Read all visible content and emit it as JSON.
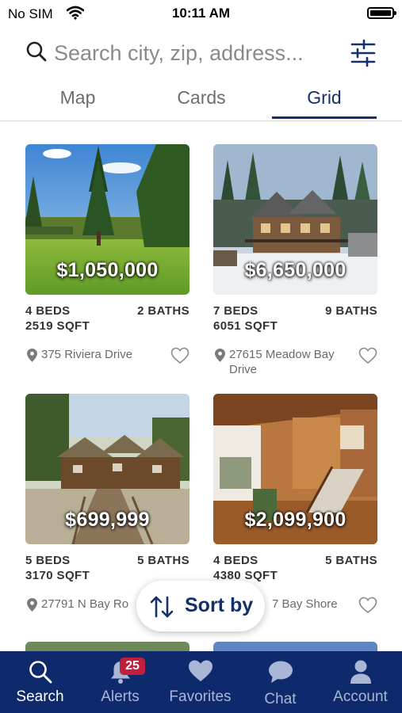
{
  "status_bar": {
    "carrier": "No SIM",
    "time": "10:11 AM"
  },
  "search": {
    "placeholder": "Search city, zip, address..."
  },
  "tabs": [
    {
      "label": "Map",
      "active": false
    },
    {
      "label": "Cards",
      "active": false
    },
    {
      "label": "Grid",
      "active": true
    }
  ],
  "listings": [
    {
      "price": "$1,050,000",
      "beds": "4 BEDS",
      "baths": "2 BATHS",
      "sqft": "2519 SQFT",
      "address": "375 Riviera Drive"
    },
    {
      "price": "$6,650,000",
      "beds": "7 BEDS",
      "baths": "9 BATHS",
      "sqft": "6051 SQFT",
      "address": "27615 Meadow Bay Drive"
    },
    {
      "price": "$699,999",
      "beds": "5 BEDS",
      "baths": "5 BATHS",
      "sqft": "3170 SQFT",
      "address": "27791 N Bay Ro"
    },
    {
      "price": "$2,099,900",
      "beds": "4 BEDS",
      "baths": "5 BATHS",
      "sqft": "4380 SQFT",
      "address": "7 Bay Shore"
    }
  ],
  "sort": {
    "label": "Sort by"
  },
  "bottom_nav": [
    {
      "label": "Search",
      "icon": "search-icon",
      "active": true
    },
    {
      "label": "Alerts",
      "icon": "bell-icon",
      "badge": "25",
      "active": false
    },
    {
      "label": "Favorites",
      "icon": "heart-icon",
      "active": false
    },
    {
      "label": "Chat",
      "icon": "chat-bubble-icon",
      "active": false
    },
    {
      "label": "Account",
      "icon": "person-icon",
      "active": false
    }
  ],
  "colors": {
    "primary": "#14306b",
    "nav_background": "#0f2a6c",
    "badge": "#c0203c"
  }
}
